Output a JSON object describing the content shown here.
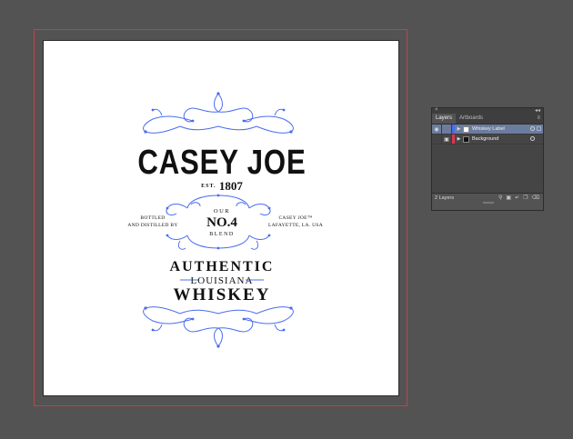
{
  "colors": {
    "canvas_bg": "#535353",
    "artboard": "#ffffff",
    "bleed_guide": "#b5474f",
    "ornament": "#4a6cf0",
    "text": "#111111",
    "layer_selected": "#6b7d9e",
    "layer_color_whiskey": "#4a6cf0",
    "layer_color_background": "#e0344d"
  },
  "artwork": {
    "brand": "CASEY JOE",
    "est_prefix": "EST.",
    "est_year": "1807",
    "left_line1": "BOTTLED",
    "left_line2": "AND DISTILLED BY",
    "right_line1": "CASEY JOE™",
    "right_line2": "LAFAYETTE, LA. USA",
    "our": "OUR",
    "number": "NO.4",
    "blend": "BLEND",
    "authentic": "AUTHENTIC",
    "louisiana": "LOUISIANA",
    "whiskey": "WHISKEY"
  },
  "panel": {
    "close_glyph": "×",
    "collapse_glyph": "◂◂",
    "tabs": [
      {
        "label": "Layers",
        "active": true
      },
      {
        "label": "Artboards",
        "active": false
      }
    ],
    "menu_glyph": "≡",
    "layers": [
      {
        "name": "Whiskey Label",
        "visible": true,
        "locked": false,
        "selected": true,
        "eye": "👁",
        "triangle": "▶"
      },
      {
        "name": "Background",
        "visible": false,
        "locked": true,
        "selected": false,
        "lock": "🔒",
        "triangle": "▶"
      }
    ],
    "count": "2 Layers",
    "footer_icons": [
      "search-icon",
      "make-clip-mask-icon",
      "new-sublayer-icon",
      "new-layer-icon",
      "delete-icon"
    ]
  }
}
